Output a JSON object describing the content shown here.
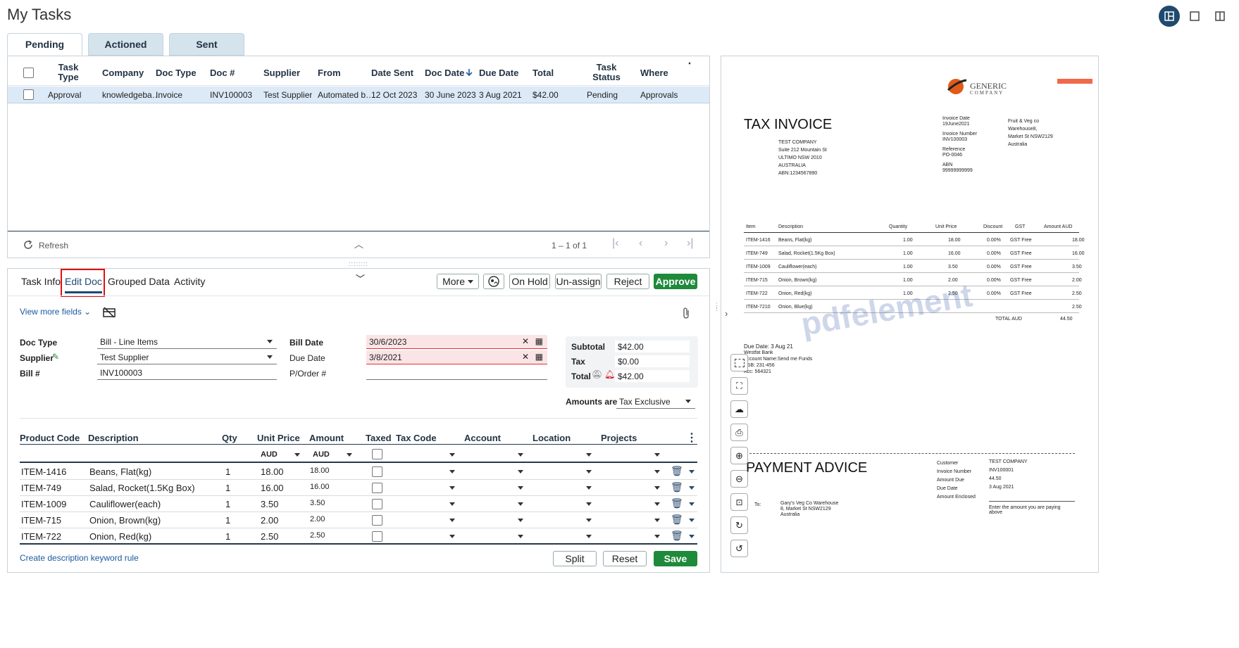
{
  "page": {
    "title": "My Tasks"
  },
  "tabs": [
    {
      "label": "Pending",
      "active": true
    },
    {
      "label": "Actioned"
    },
    {
      "label": "Sent"
    }
  ],
  "task_grid": {
    "columns": [
      "Task Type",
      "Company",
      "Doc Type",
      "Doc #",
      "Supplier",
      "From",
      "Date Sent",
      "Doc Date",
      "Due Date",
      "Total",
      "Task Status",
      "Where"
    ],
    "rows": [
      {
        "task_type": "Approval",
        "company": "knowledgeba…",
        "doc_type": "Invoice",
        "doc_no": "INV100003",
        "supplier": "Test Supplier",
        "from": "Automated b…",
        "date_sent": "12 Oct 2023",
        "doc_date": "30 June 2023",
        "due_date": "3 Aug 2021",
        "total": "$42.00",
        "status": "Pending",
        "where": "Approvals"
      }
    ],
    "refresh_label": "Refresh",
    "pagination": "1 – 1 of 1"
  },
  "detail_tabs": [
    "Task Info",
    "Edit Doc",
    "Grouped Data",
    "Activity"
  ],
  "toolbar": {
    "more": "More",
    "on_hold": "On Hold",
    "unassign": "Un-assign",
    "reject": "Reject",
    "approve": "Approve"
  },
  "edit_doc": {
    "view_more": "View more fields",
    "doc_type_label": "Doc Type",
    "doc_type_value": "Bill - Line Items",
    "supplier_label": "Supplier",
    "supplier_value": "Test Supplier",
    "bill_no_label": "Bill #",
    "bill_no_value": "INV100003",
    "bill_date_label": "Bill Date",
    "bill_date_value": "30/6/2023",
    "due_date_label": "Due Date",
    "due_date_value": "3/8/2021",
    "porder_label": "P/Order #",
    "subtotal_label": "Subtotal",
    "subtotal_value": "$42.00",
    "tax_label": "Tax",
    "tax_value": "$0.00",
    "total_label": "Total",
    "total_value": "$42.00",
    "amounts_are_label": "Amounts are",
    "amounts_are_value": "Tax Exclusive"
  },
  "line_items": {
    "columns": [
      "Product Code",
      "Description",
      "Qty",
      "Unit Price",
      "Amount",
      "Taxed",
      "Tax Code",
      "Account",
      "Location",
      "Projects"
    ],
    "currency": "AUD",
    "rows": [
      {
        "code": "ITEM-1416",
        "desc": "Beans, Flat(kg)",
        "qty": "1",
        "unit": "18.00",
        "amount": "18.00"
      },
      {
        "code": "ITEM-749",
        "desc": "Salad, Rocket(1.5Kg Box)",
        "qty": "1",
        "unit": "16.00",
        "amount": "16.00"
      },
      {
        "code": "ITEM-1009",
        "desc": "Cauliflower(each)",
        "qty": "1",
        "unit": "3.50",
        "amount": "3.50"
      },
      {
        "code": "ITEM-715",
        "desc": "Onion, Brown(kg)",
        "qty": "1",
        "unit": "2.00",
        "amount": "2.00"
      },
      {
        "code": "ITEM-722",
        "desc": "Onion, Red(kg)",
        "qty": "1",
        "unit": "2.50",
        "amount": "2.50"
      }
    ],
    "keyword_rule_link": "Create description keyword rule",
    "split": "Split",
    "reset": "Reset",
    "save": "Save"
  },
  "pdf": {
    "title": "TAX INVOICE",
    "logo_line1": "GENERIC",
    "logo_line2": "COMPANY",
    "bill_to": [
      "TEST COMPANY",
      "Suite 212 Mountain St",
      "ULTIMO NSW 2010",
      "AUSTRALIA",
      "ABN:1234567890"
    ],
    "meta": [
      "Invoice Date",
      "19June2021",
      "Invoice Number",
      "INV100003",
      "Reference",
      "PO-0046",
      "ABN",
      "99999999999"
    ],
    "from": [
      "Fruit & Veg co",
      "Warehouse8,",
      "Market St NSW2129",
      "Australia"
    ],
    "table_head": [
      "Item",
      "Description",
      "Quantity",
      "Unit Price",
      "Discount",
      "GST",
      "Amount AUD"
    ],
    "rows": [
      [
        "ITEM-1416",
        "Beans, Flat(kg)",
        "1.00",
        "18.00",
        "0.00%",
        "GST Free",
        "18.00"
      ],
      [
        "ITEM-749",
        "Salad, Rocket(1.5Kg Box)",
        "1.00",
        "16.00",
        "0.00%",
        "GST Free",
        "16.00"
      ],
      [
        "ITEM-1009",
        "Cauliflower(each)",
        "1.00",
        "3.50",
        "0.00%",
        "GST Free",
        "3.50"
      ],
      [
        "ITEM-715",
        "Onion, Brown(kg)",
        "1.00",
        "2.00",
        "0.00%",
        "GST Free",
        "2.00"
      ],
      [
        "ITEM-722",
        "Onion, Red(kg)",
        "1.00",
        "2.50",
        "0.00%",
        "GST Free",
        "2.50"
      ],
      [
        "ITEM-7210",
        "Onion, Blue(kg)",
        "",
        "",
        "",
        "",
        "2.50"
      ]
    ],
    "total_label": "TOTAL AUD",
    "total_value": "44.50",
    "due": [
      "Due Date: 3 Aug 21",
      "Westfat Bank",
      "Account Name:Send me Funds",
      "BSB: 231-456",
      "Acc: 564321"
    ],
    "watermark": "pdfelement",
    "payment_title": "PAYMENT ADVICE",
    "to_label": "To:",
    "to": [
      "Gary's Veg Co Warehouse",
      "8, Market St NSW2129",
      "Australia"
    ],
    "pay_labels": [
      "Customer",
      "Invoice Number",
      "Amount Due",
      "Due Date",
      "Amount Enclosed"
    ],
    "pay_values": [
      "TEST COMPANY",
      "INV100001",
      "44.50",
      "3 Aug 2021"
    ],
    "enter_amount": "Enter the amount you are paying above"
  }
}
